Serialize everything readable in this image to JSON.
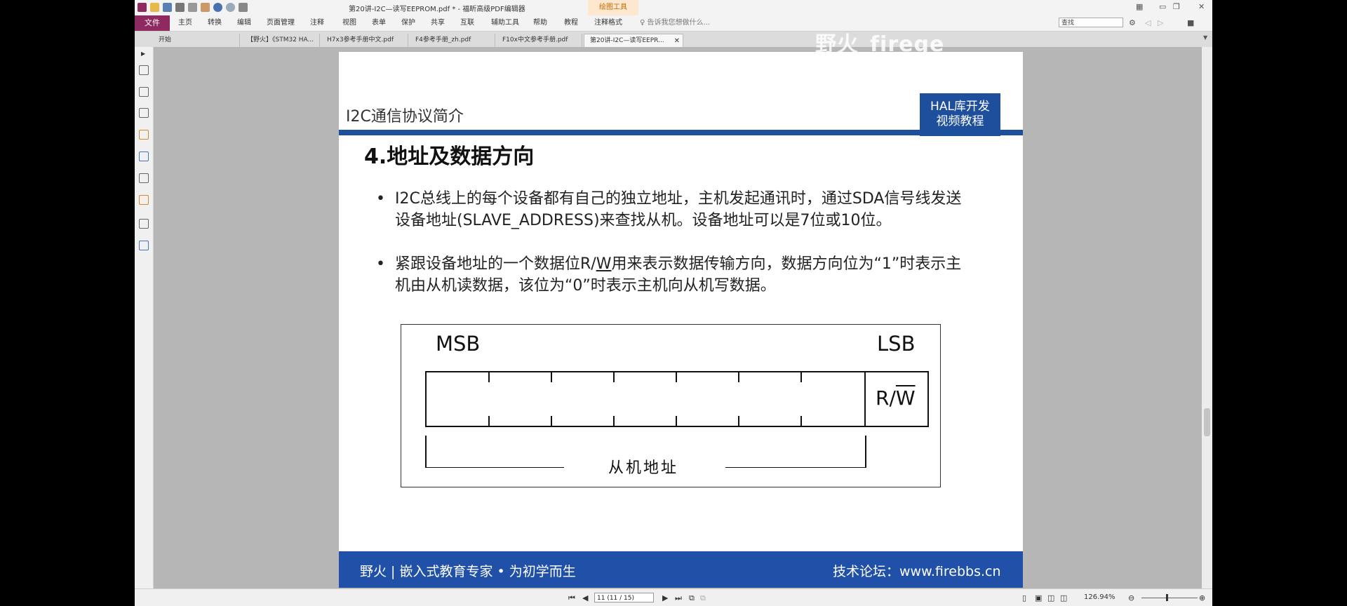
{
  "window": {
    "title": "第20讲-I2C—读写EEPROM.pdf * - 福昕高级PDF编辑器",
    "context_tab": "绘图工具"
  },
  "menu": {
    "file": "文件",
    "items": [
      "主页",
      "转换",
      "编辑",
      "页面管理",
      "注释",
      "视图",
      "表单",
      "保护",
      "共享",
      "互联",
      "辅助工具",
      "帮助",
      "教程",
      "注释格式"
    ],
    "tell_me": "告诉我您想做什么...",
    "search_placeholder": "查找"
  },
  "tabs": [
    {
      "label": "开始"
    },
    {
      "label": "【野火】《STM32 HA..."
    },
    {
      "label": "H7x3参考手册中文.pdf"
    },
    {
      "label": "F4参考手册_zh.pdf"
    },
    {
      "label": "F10x中文参考手册.pdf"
    },
    {
      "label": "第20讲-I2C—读写EEPR..."
    }
  ],
  "watermark": "野火_firege",
  "slide": {
    "section_title": "I2C通信协议简介",
    "badge": [
      "HAL库开发",
      "视频教程"
    ],
    "heading": "4.地址及数据方向",
    "bullet_marker": "•",
    "bullet1": "I2C总线上的每个设备都有自己的独立地址，主机发起通讯时，通过SDA信号线发送设备地址(SLAVE_ADDRESS)来查找从机。设备地址可以是7位或10位。",
    "bullet2_pre": "紧跟设备地址的一个数据位R/",
    "bullet2_w": "W",
    "bullet2_post": "用来表示数据传输方向，数据方向位为“1”时表示主机由从机读数据，该位为“0”时表示主机向从机写数据。",
    "diagram": {
      "msb": "MSB",
      "lsb": "LSB",
      "rw_r": "R/",
      "rw_w": "W",
      "slave_address": "从机地址"
    },
    "footer_left": "野火 | 嵌入式教育专家 • 为初学而生",
    "footer_right": "技术论坛：www.firebbs.cn"
  },
  "status": {
    "page": "11 (11 / 15)",
    "zoom": "126.94%"
  }
}
